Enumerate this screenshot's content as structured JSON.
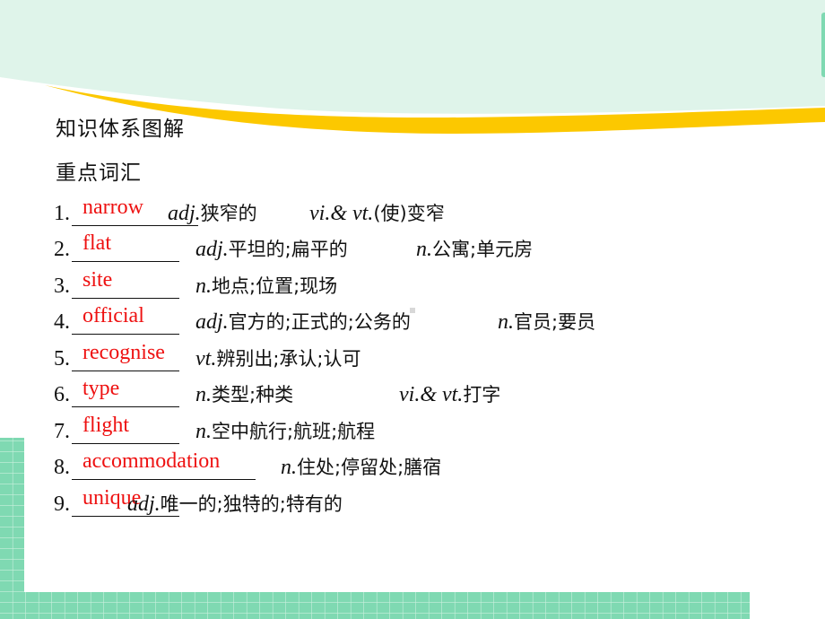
{
  "slide": {
    "title": "知识体系图解",
    "subtitle": "重点词汇",
    "colors": {
      "banner": "#dff4ea",
      "swoosh": "#fcc800",
      "grid": "#7fd9b2",
      "answer": "#ee1111"
    },
    "items": [
      {
        "num": "1.",
        "answer": "narrow",
        "defs": [
          {
            "pos": "adj.",
            "cn": "狭窄的"
          },
          {
            "pos": "vi.& vt.",
            "cn": "(使)变窄"
          }
        ]
      },
      {
        "num": "2.",
        "answer": "flat",
        "defs": [
          {
            "pos": "adj.",
            "cn": "平坦的;扁平的"
          },
          {
            "pos": "n.",
            "cn": "公寓;单元房"
          }
        ]
      },
      {
        "num": "3.",
        "answer": "site",
        "defs": [
          {
            "pos": "n.",
            "cn": "地点;位置;现场"
          }
        ]
      },
      {
        "num": "4.",
        "answer": "official",
        "defs": [
          {
            "pos": "adj.",
            "cn": "官方的;正式的;公务的"
          },
          {
            "pos": "n.",
            "cn": "官员;要员"
          }
        ]
      },
      {
        "num": "5.",
        "answer": "recognise",
        "defs": [
          {
            "pos": "vt.",
            "cn": "辨别出;承认;认可"
          }
        ]
      },
      {
        "num": "6.",
        "answer": "type",
        "defs": [
          {
            "pos": "n.",
            "cn": "类型;种类"
          },
          {
            "pos": "vi.& vt.",
            "cn": "打字"
          }
        ]
      },
      {
        "num": "7.",
        "answer": "flight",
        "defs": [
          {
            "pos": "n.",
            "cn": "空中航行;航班;航程"
          }
        ]
      },
      {
        "num": "8.",
        "answer": "accommodation",
        "defs": [
          {
            "pos": "n.",
            "cn": "住处;停留处;膳宿"
          }
        ]
      },
      {
        "num": "9.",
        "answer": "unique",
        "defs": [
          {
            "pos": "adj.",
            "cn": "唯一的;独特的;特有的"
          }
        ]
      }
    ]
  }
}
